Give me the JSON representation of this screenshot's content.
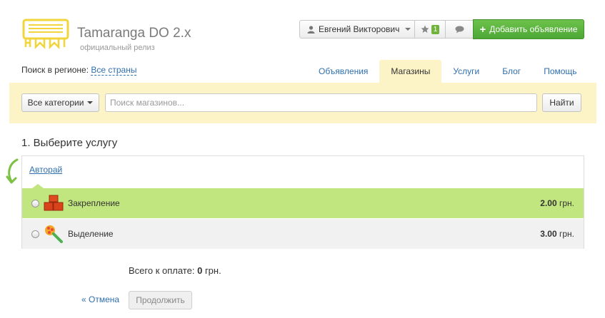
{
  "brand": {
    "title": "Tamaranga DO 2.x",
    "subtitle": "официальный релиз",
    "logo_color": "#f2d43b"
  },
  "header": {
    "user_name": "Евгений Викторович",
    "favorites_count": "1",
    "add_button_label": "Добавить объявление",
    "accent_color": "#5cb83f"
  },
  "region": {
    "label": "Поиск в регионе:",
    "value": "Все страны"
  },
  "tabs": [
    {
      "label": "Объявления",
      "active": false
    },
    {
      "label": "Магазины",
      "active": true
    },
    {
      "label": "Услуги",
      "active": false
    },
    {
      "label": "Блог",
      "active": false
    },
    {
      "label": "Помощь",
      "active": false
    }
  ],
  "search": {
    "category_label": "Все категории",
    "placeholder": "Поиск магазинов...",
    "value": "",
    "submit_label": "Найти",
    "bg_color": "#fcf3c7"
  },
  "step": {
    "title": "1. Выберите услугу",
    "shop_link": "Авторай",
    "services": [
      {
        "name": "Закрепление",
        "price": "2.00",
        "currency": "грн.",
        "icon": "bricks-icon",
        "selected": true
      },
      {
        "name": "Выделение",
        "price": "3.00",
        "currency": "грн.",
        "icon": "highlight-brush-icon",
        "selected": false
      }
    ]
  },
  "total": {
    "label": "Всего к оплате:",
    "value": "0",
    "currency": "грн."
  },
  "actions": {
    "cancel_label": "« Отмена",
    "continue_label": "Продолжить"
  }
}
